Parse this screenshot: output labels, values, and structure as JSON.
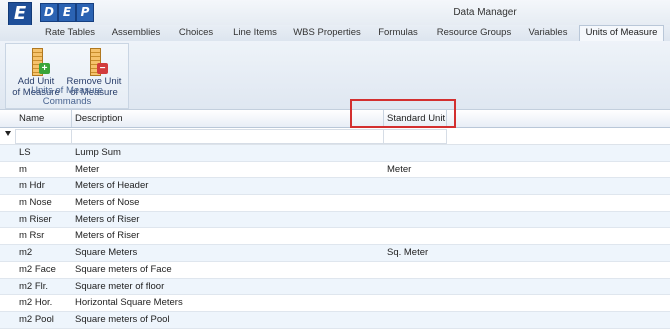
{
  "window": {
    "title": "Data Manager"
  },
  "logo": {
    "letters": [
      "E",
      "D",
      "E",
      "P"
    ]
  },
  "tabs": [
    {
      "label": "Rate Tables"
    },
    {
      "label": "Assemblies"
    },
    {
      "label": "Choices"
    },
    {
      "label": "Line Items"
    },
    {
      "label": "WBS Properties"
    },
    {
      "label": "Formulas"
    },
    {
      "label": "Resource Groups"
    },
    {
      "label": "Variables"
    },
    {
      "label": "Units of Measure",
      "active": true
    }
  ],
  "ribbon": {
    "group_label": "Units of Measure Commands",
    "add_button": {
      "line1": "Add Unit",
      "line2": "of Measure",
      "icon": "ruler-add-icon"
    },
    "remove_button": {
      "line1": "Remove Unit",
      "line2": "of Measure",
      "icon": "ruler-remove-icon"
    }
  },
  "grid": {
    "columns": [
      "Name",
      "Description",
      "Standard Unit"
    ],
    "filter_icon": "filter-icon",
    "rows": [
      {
        "name": "LS",
        "description": "Lump Sum",
        "standard": ""
      },
      {
        "name": "m",
        "description": "Meter",
        "standard": "Meter"
      },
      {
        "name": "m Hdr",
        "description": "Meters of Header",
        "standard": ""
      },
      {
        "name": "m Nose",
        "description": "Meters of Nose",
        "standard": ""
      },
      {
        "name": "m Riser",
        "description": "Meters of Riser",
        "standard": ""
      },
      {
        "name": "m Rsr",
        "description": "Meters of Riser",
        "standard": ""
      },
      {
        "name": "m2",
        "description": "Square Meters",
        "standard": "Sq. Meter"
      },
      {
        "name": "m2 Face",
        "description": "Square meters of Face",
        "standard": ""
      },
      {
        "name": "m2 Flr.",
        "description": "Square meter of floor",
        "standard": ""
      },
      {
        "name": "m2 Hor.",
        "description": "Horizontal Square Meters",
        "standard": ""
      },
      {
        "name": "m2 Pool",
        "description": "Square meters of Pool",
        "standard": ""
      }
    ]
  },
  "colors": {
    "highlight": "#d32f2f",
    "accent": "#1f4f99"
  }
}
